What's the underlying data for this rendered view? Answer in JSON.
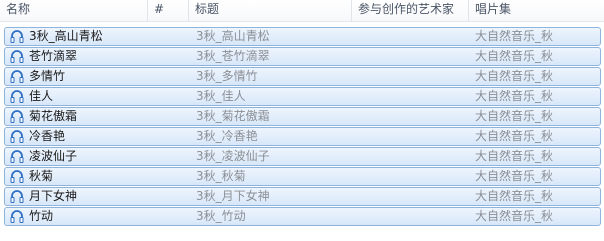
{
  "columns": {
    "name": "名称",
    "number": "#",
    "title": "标题",
    "artist": "参与创作的艺术家",
    "album": "唱片集"
  },
  "icon": "music-file-icon",
  "colors": {
    "row_border": "#8fb4dc",
    "row_fill_top": "#eef5fd",
    "row_fill_bottom": "#d7e7f9",
    "icon_blue": "#2f6fc4",
    "muted_text": "#8a8f96"
  },
  "rows": [
    {
      "name": "3秋_高山青松",
      "title": "3秋_高山青松",
      "album": "大自然音乐_秋"
    },
    {
      "name": "苍竹滴翠",
      "title": "3秋_苍竹滴翠",
      "album": "大自然音乐_秋"
    },
    {
      "name": "多情竹",
      "title": "3秋_多情竹",
      "album": "大自然音乐_秋"
    },
    {
      "name": "佳人",
      "title": "3秋_佳人",
      "album": "大自然音乐_秋"
    },
    {
      "name": "菊花傲霜",
      "title": "3秋_菊花傲霜",
      "album": "大自然音乐_秋"
    },
    {
      "name": "冷香艳",
      "title": "3秋_冷香艳",
      "album": "大自然音乐_秋"
    },
    {
      "name": "凌波仙子",
      "title": "3秋_凌波仙子",
      "album": "大自然音乐_秋"
    },
    {
      "name": "秋菊",
      "title": "3秋_秋菊",
      "album": "大自然音乐_秋"
    },
    {
      "name": "月下女神",
      "title": "3秋_月下女神",
      "album": "大自然音乐_秋"
    },
    {
      "name": "竹动",
      "title": "3秋_竹动",
      "album": "大自然音乐_秋"
    }
  ]
}
